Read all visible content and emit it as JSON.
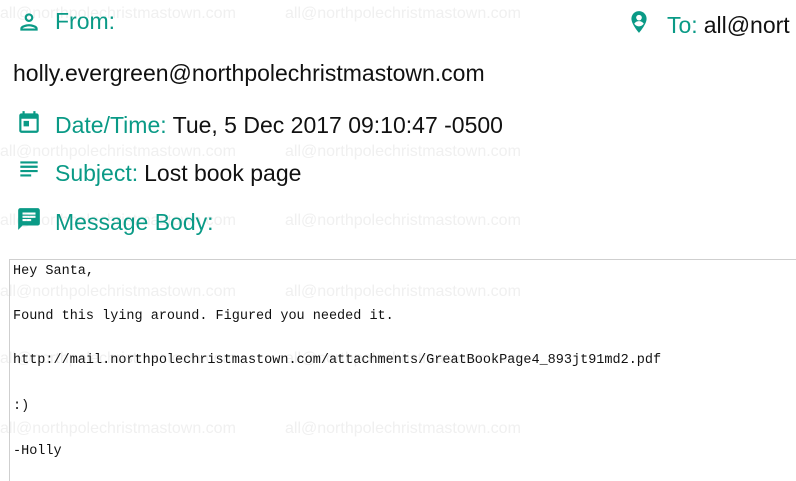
{
  "watermark": {
    "text": "all@northpolechristmastown.com"
  },
  "header": {
    "from": {
      "icon": "person-icon",
      "label": "From:",
      "value": "holly.evergreen@northpolechristmastown.com"
    },
    "to": {
      "icon": "account-circle-icon",
      "label": "To:",
      "value": "all@nort"
    },
    "datetime": {
      "icon": "calendar-icon",
      "label": "Date/Time:",
      "value": "Tue, 5 Dec 2017 09:10:47 -0500"
    },
    "subject": {
      "icon": "subject-lines-icon",
      "label": "Subject:",
      "value": "Lost book page"
    },
    "message_body": {
      "icon": "chat-bubble-icon",
      "label": "Message Body:"
    }
  },
  "message": {
    "lines": [
      "Hey Santa,",
      "Found this lying around. Figured you needed it.",
      "http://mail.northpolechristmastown.com/attachments/GreatBookPage4_893jt91md2.pdf",
      ":)",
      "-Holly"
    ]
  },
  "colors": {
    "accent": "#0a9a86",
    "text": "#111111",
    "watermark": "#f0f0f0"
  }
}
